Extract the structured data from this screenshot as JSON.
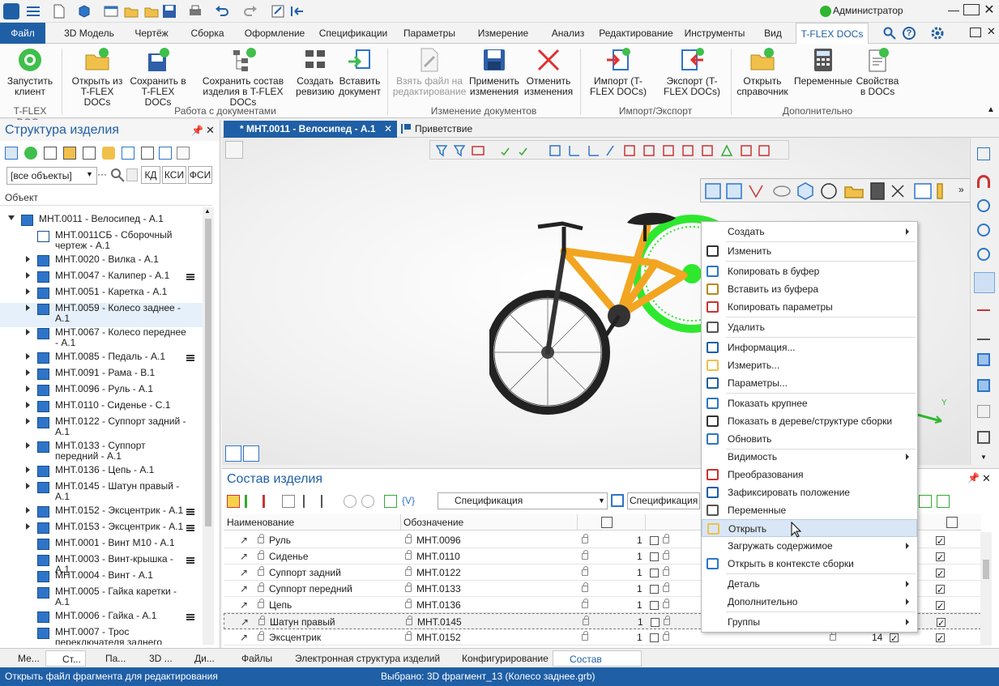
{
  "title_bar": {
    "user": "Администратор"
  },
  "ribbon_tabs": [
    "Файл",
    "3D Модель",
    "Чертёж",
    "Сборка",
    "Оформление",
    "Спецификации",
    "Параметры",
    "Измерение",
    "Анализ",
    "Редактирование",
    "Инструменты",
    "Вид",
    "T-FLEX DOCs"
  ],
  "ribbon": {
    "buttons": [
      {
        "label": "Запустить клиент",
        "group": "T-FLEX DOCs",
        "enabled": true,
        "icon": "docs-client-icon"
      },
      {
        "label": "Открыть из T-FLEX DOCs",
        "enabled": true,
        "icon": "open-folder-icon"
      },
      {
        "label": "Сохранить в T-FLEX DOCs",
        "enabled": true,
        "icon": "save-disk-icon"
      },
      {
        "label": "Сохранить состав изделия в T-FLEX DOCs",
        "enabled": true,
        "icon": "save-structure-icon"
      },
      {
        "label": "Создать ревизию",
        "enabled": true,
        "icon": "revision-icon"
      },
      {
        "label": "Вставить документ",
        "enabled": true,
        "icon": "insert-document-icon"
      },
      {
        "label": "Взять файл на редактирование",
        "enabled": false,
        "icon": "edit-file-icon"
      },
      {
        "label": "Применить изменения",
        "enabled": true,
        "icon": "apply-save-icon"
      },
      {
        "label": "Отменить изменения",
        "enabled": true,
        "icon": "cancel-x-icon"
      },
      {
        "label": "Импорт (T-FLEX DOCs)",
        "enabled": true,
        "icon": "import-icon"
      },
      {
        "label": "Экспорт (T-FLEX DOCs)",
        "enabled": true,
        "icon": "export-icon"
      },
      {
        "label": "Открыть справочник",
        "enabled": true,
        "icon": "open-reference-icon"
      },
      {
        "label": "Переменные",
        "enabled": true,
        "icon": "variables-icon"
      },
      {
        "label": "Свойства в DOCs",
        "enabled": true,
        "icon": "docs-properties-icon"
      }
    ],
    "groups": [
      "T-FLEX DOCs",
      "Работа с документами",
      "Изменение документов",
      "Импорт/Экспорт",
      "Дополнительно"
    ]
  },
  "left_panel": {
    "title": "Структура изделия",
    "filter_value": "[все объекты]",
    "filter_buttons": [
      "КД",
      "КСИ",
      "ФСИ"
    ],
    "column": "Объект",
    "items": [
      {
        "label": "МНТ.0011 - Велосипед - А.1"
      },
      {
        "label": "МНТ.0011СБ - Сборочный чертеж - А.1"
      },
      {
        "label": "МНТ.0020 - Вилка - А.1"
      },
      {
        "label": "МНТ.0047 - Калипер - А.1"
      },
      {
        "label": "МНТ.0051 - Каретка - А.1"
      },
      {
        "label": "МНТ.0059 - Колесо заднее - А.1"
      },
      {
        "label": "МНТ.0067 - Колесо переднее - А.1"
      },
      {
        "label": "МНТ.0085 - Педаль - А.1"
      },
      {
        "label": "МНТ.0091 - Рама - В.1"
      },
      {
        "label": "МНТ.0096 - Руль - А.1"
      },
      {
        "label": "МНТ.0110 - Сиденье - С.1"
      },
      {
        "label": "МНТ.0122 - Суппорт задний - А.1"
      },
      {
        "label": "МНТ.0133 - Суппорт передний - А.1"
      },
      {
        "label": "МНТ.0136 - Цепь - А.1"
      },
      {
        "label": "МНТ.0145 - Шатун правый - А.1"
      },
      {
        "label": "МНТ.0152 - Эксцентрик - А.1"
      },
      {
        "label": "МНТ.0153 - Эксцентрик - А.1"
      },
      {
        "label": "МНТ.0001 - Винт М10 - А.1"
      },
      {
        "label": "МНТ.0003 - Винт-крышка - А.1"
      },
      {
        "label": "МНТ.0004 - Винт - А.1"
      },
      {
        "label": "МНТ.0005 - Гайка каретки - А.1"
      },
      {
        "label": "МНТ.0006 - Гайка - А.1"
      },
      {
        "label": "МНТ.0007 - Трос переключателя заднего"
      }
    ]
  },
  "doc_tabs": [
    {
      "label": "* МНТ.0011 - Велосипед - А.1",
      "active": true
    },
    {
      "label": "Приветствие",
      "active": false
    }
  ],
  "bottom_panel": {
    "title": "Состав изделия",
    "view_select": "Спецификация",
    "view_select2": "Спецификация",
    "columns": [
      "Наименование",
      "Обозначение"
    ],
    "rows": [
      {
        "name": "Руль",
        "designation": "МНТ.0096",
        "qty": "1"
      },
      {
        "name": "Сиденье",
        "designation": "МНТ.0110",
        "qty": "1"
      },
      {
        "name": "Суппорт задний",
        "designation": "МНТ.0122",
        "qty": "1"
      },
      {
        "name": "Суппорт передний",
        "designation": "МНТ.0133",
        "qty": "1"
      },
      {
        "name": "Цепь",
        "designation": "МНТ.0136",
        "qty": "1"
      },
      {
        "name": "Шатун правый",
        "designation": "МНТ.0145",
        "qty": "1"
      },
      {
        "name": "Эксцентрик",
        "designation": "МНТ.0152",
        "qty": "1"
      }
    ],
    "extra_qty": "14"
  },
  "context_menu": [
    {
      "label": "Создать",
      "submenu": true,
      "icon": ""
    },
    {
      "label": "Изменить",
      "icon": "scissors-icon"
    },
    {
      "label": "Копировать в буфер",
      "icon": "copy-icon"
    },
    {
      "label": "Вставить из буфера",
      "icon": "paste-icon"
    },
    {
      "label": "Копировать параметры",
      "icon": "copy-params-icon"
    },
    {
      "label": "Удалить",
      "icon": "trash-icon"
    },
    {
      "label": "Информация...",
      "icon": "info-icon"
    },
    {
      "label": "Измерить...",
      "icon": "measure-icon"
    },
    {
      "label": "Параметры...",
      "icon": "parameters-icon"
    },
    {
      "label": "Показать крупнее",
      "icon": "zoom-icon"
    },
    {
      "label": "Показать в дереве/структуре сборки",
      "icon": "target-icon"
    },
    {
      "label": "Обновить",
      "icon": "update-icon"
    },
    {
      "label": "Видимость",
      "submenu": true,
      "icon": ""
    },
    {
      "label": "Преобразования",
      "icon": "transform-icon"
    },
    {
      "label": "Зафиксировать положение",
      "icon": "anchor-icon"
    },
    {
      "label": "Переменные",
      "icon": "variables-icon"
    },
    {
      "label": "Открыть",
      "icon": "open-folder-icon",
      "highlighted": true
    },
    {
      "label": "Загружать содержимое",
      "submenu": true,
      "icon": ""
    },
    {
      "label": "Открыть в контексте сборки",
      "icon": "open-context-icon"
    },
    {
      "label": "Деталь",
      "submenu": true,
      "icon": ""
    },
    {
      "label": "Дополнительно",
      "submenu": true,
      "icon": ""
    },
    {
      "label": "Группы",
      "submenu": true,
      "icon": ""
    }
  ],
  "bottom_tabs_left": [
    "Ме...",
    "Ст...",
    "Па...",
    "3D ...",
    "Ди..."
  ],
  "bottom_tabs_right": [
    "Файлы",
    "Электронная структура изделий",
    "Конфигурирование",
    "Состав изделия"
  ],
  "status": {
    "left": "Открыть файл фрагмента для редактирования",
    "center": "Выбрано: 3D фрагмент_13 (Колесо заднее.grb)"
  },
  "colors": {
    "accent": "#1f5fa6",
    "bike_frame": "#f2a521",
    "highlight_green": "#2ee82e"
  }
}
